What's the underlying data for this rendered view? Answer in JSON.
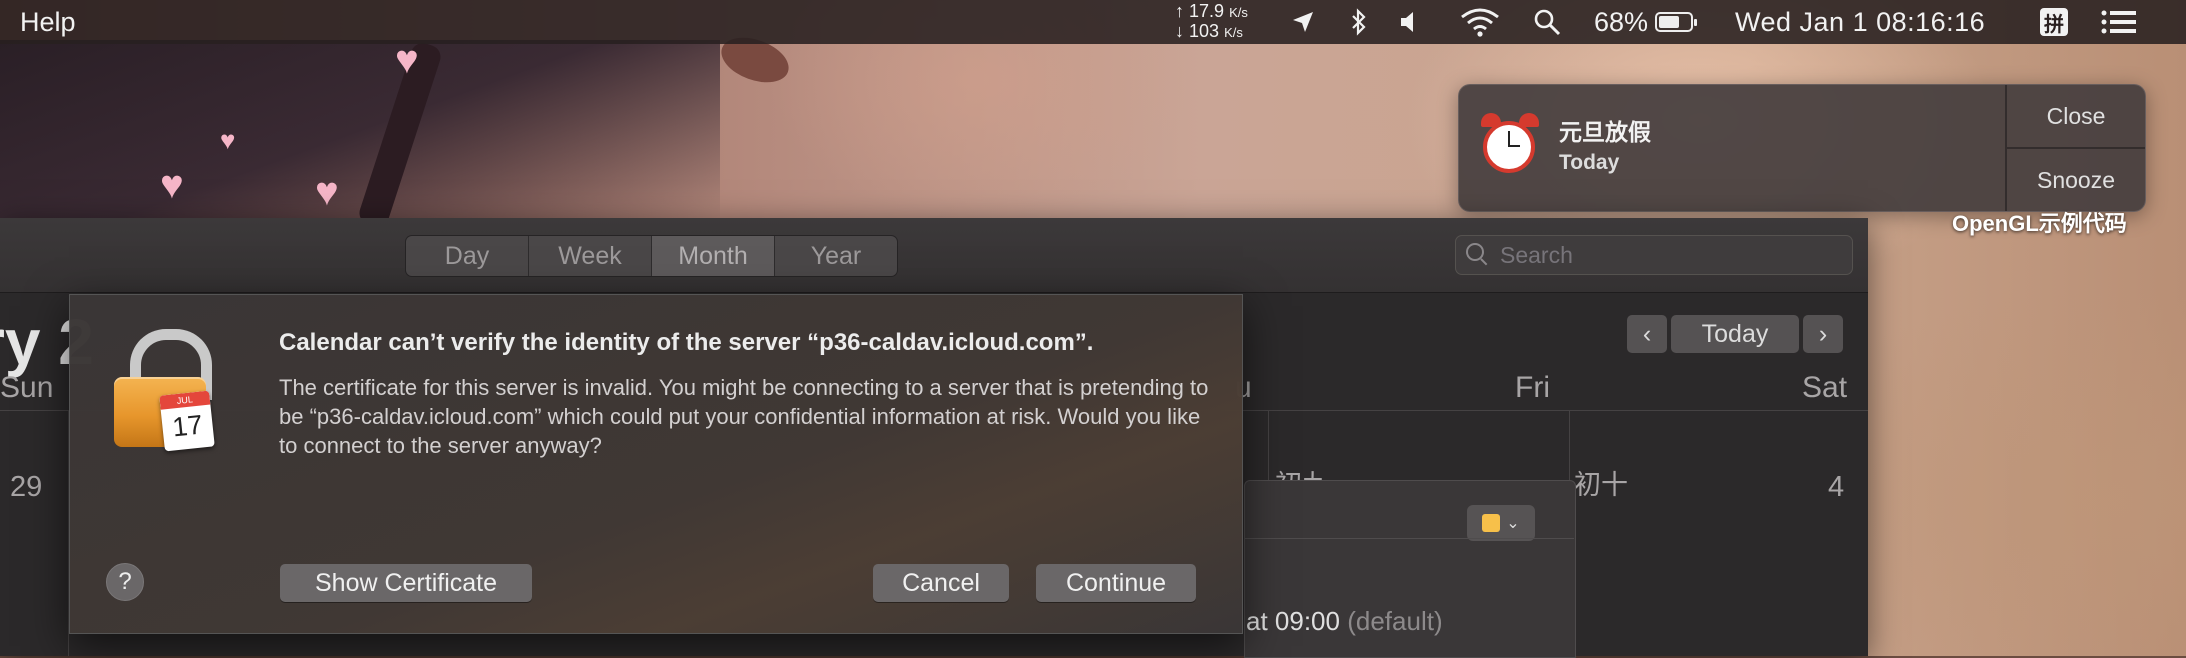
{
  "menubar": {
    "app_menu": "Help",
    "net_up": "17.9",
    "net_down": "103",
    "net_unit": "K/s",
    "battery_pct": "68%",
    "battery_level": 0.68,
    "datetime": "Wed Jan 1  08:16:16",
    "input_method": "拼"
  },
  "calendar": {
    "view_tabs": [
      "Day",
      "Week",
      "Month",
      "Year"
    ],
    "active_view": "Month",
    "search_placeholder": "Search",
    "month_title_fragment": "ry 2",
    "nav": {
      "prev": "‹",
      "today": "Today",
      "next": "›"
    },
    "day_headers": {
      "sun": "Sun",
      "thu_fragment": "u",
      "fri": "Fri",
      "sat": "Sat"
    },
    "cells": {
      "sun_date": "29",
      "thu_lunar_fragment": "初九",
      "fri_lunar": "初十",
      "sat_date": "4"
    },
    "event_popover": {
      "alert_text": "at 09:00",
      "alert_default": "(default)"
    }
  },
  "dialog": {
    "title": "Calendar can’t verify the identity of the server “p36-caldav.icloud.com”.",
    "body": "The certificate for this server is invalid. You might be connecting to a server that is pretending to be “p36-caldav.icloud.com” which could put your confidential information at risk. Would you like to connect to the server anyway?",
    "help": "?",
    "show_cert": "Show Certificate",
    "cancel": "Cancel",
    "continue": "Continue",
    "icon_cal_month": "JUL",
    "icon_cal_day": "17"
  },
  "notification": {
    "title": "元旦放假",
    "subtitle": "Today",
    "close": "Close",
    "snooze": "Snooze"
  },
  "desktop": {
    "label": "OpenGL示例代码"
  }
}
